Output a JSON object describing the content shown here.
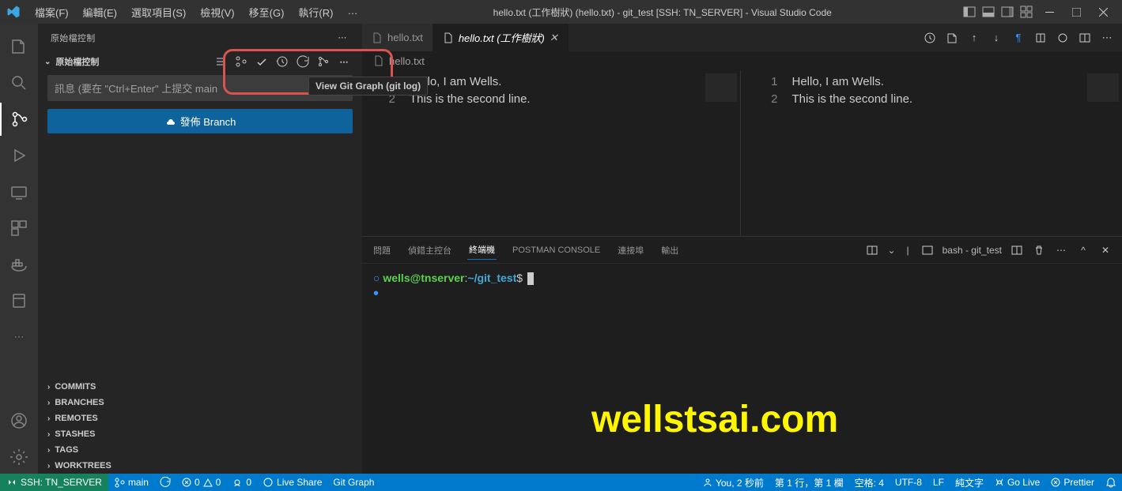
{
  "titlebar": {
    "menus": [
      "檔案(F)",
      "編輯(E)",
      "選取項目(S)",
      "檢視(V)",
      "移至(G)",
      "執行(R)",
      "…"
    ],
    "title": "hello.txt (工作樹狀) (hello.txt) - git_test [SSH: TN_SERVER] - Visual Studio Code"
  },
  "sidebar": {
    "header": "原始檔控制",
    "section": "原始檔控制",
    "commit_placeholder": "訊息 (要在 \"Ctrl+Enter\" 上提交 main",
    "publish_label": "發佈 Branch",
    "tooltip": "View Git Graph (git log)",
    "groups": [
      "COMMITS",
      "BRANCHES",
      "REMOTES",
      "STASHES",
      "TAGS",
      "WORKTREES"
    ]
  },
  "tabs": {
    "items": [
      {
        "label": "hello.txt",
        "active": false,
        "italic": false
      },
      {
        "label": "hello.txt (工作樹狀)",
        "active": true,
        "italic": true
      }
    ]
  },
  "breadcrumb": "hello.txt",
  "editor": {
    "left": {
      "lines": [
        {
          "n": "1",
          "t": "Hello, I am Wells."
        },
        {
          "n": "2",
          "t": "This is the second line."
        }
      ]
    },
    "right": {
      "lines": [
        {
          "n": "1",
          "t": "Hello, I am Wells."
        },
        {
          "n": "2",
          "t": "This is the second line."
        }
      ]
    }
  },
  "panel": {
    "tabs": [
      "問題",
      "偵錯主控台",
      "終端機",
      "POSTMAN CONSOLE",
      "連接埠",
      "輸出"
    ],
    "active_idx": 2,
    "terminal_label": "bash - git_test",
    "prompt_user": "wells@tnserver",
    "prompt_sep": ":",
    "prompt_path": "~/git_test",
    "prompt_end": "$"
  },
  "status": {
    "remote": "SSH: TN_SERVER",
    "branch": "main",
    "sync": "",
    "errors": "0",
    "warnings": "0",
    "ports": "0",
    "liveshare": "Live Share",
    "gitgraph": "Git Graph",
    "you": "You, 2 秒前",
    "pos": "第 1 行，第 1 欄",
    "spaces": "空格: 4",
    "encoding": "UTF-8",
    "eol": "LF",
    "mode": "純文字",
    "golive": "Go Live",
    "prettier": "Prettier"
  },
  "watermark": "wellstsai.com"
}
